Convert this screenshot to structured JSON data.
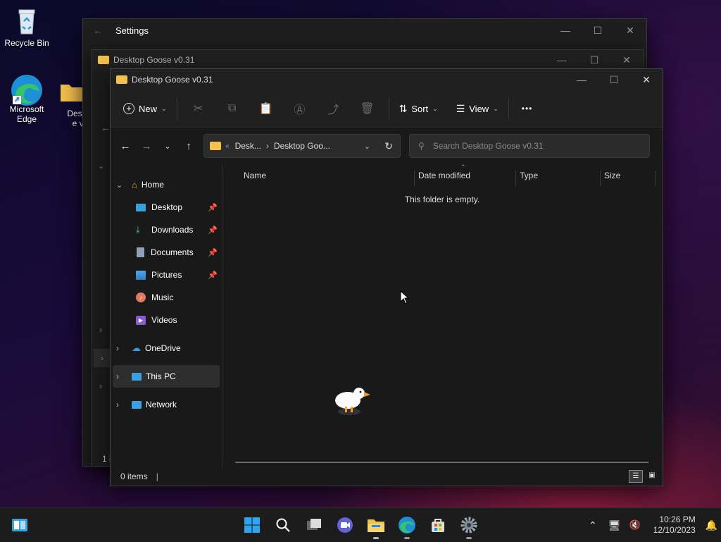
{
  "desktop": {
    "icons": [
      {
        "label": "Recycle Bin"
      },
      {
        "label": "Microsoft Edge"
      },
      {
        "label": "Deskto e v0"
      }
    ]
  },
  "settings_window": {
    "title": "Settings"
  },
  "mid_window": {
    "title": "Desktop Goose v0.31",
    "status_partial": "1 i"
  },
  "explorer": {
    "title": "Desktop Goose v0.31",
    "toolbar": {
      "new_label": "New",
      "sort_label": "Sort",
      "view_label": "View",
      "more_label": "•••"
    },
    "address": {
      "crumb_prefix": "«",
      "crumb1": "Desk...",
      "crumb_sep": "›",
      "crumb2": "Desktop Goo..."
    },
    "search": {
      "placeholder": "Search Desktop Goose v0.31"
    },
    "nav": {
      "home": "Home",
      "quick": [
        {
          "label": "Desktop",
          "pinned": true
        },
        {
          "label": "Downloads",
          "pinned": true
        },
        {
          "label": "Documents",
          "pinned": true
        },
        {
          "label": "Pictures",
          "pinned": true
        },
        {
          "label": "Music",
          "pinned": false
        },
        {
          "label": "Videos",
          "pinned": false
        }
      ],
      "onedrive": "OneDrive",
      "thispc": "This PC",
      "network": "Network"
    },
    "columns": {
      "name": "Name",
      "date": "Date modified",
      "type": "Type",
      "size": "Size"
    },
    "empty_message": "This folder is empty.",
    "status": {
      "items": "0 items",
      "cursor": "|"
    }
  },
  "taskbar": {
    "clock_time": "10:26 PM",
    "clock_date": "12/10/2023"
  },
  "colors": {
    "accent": "#0078d4",
    "folder": "#f2c14e",
    "window_bg": "#191919",
    "taskbar_bg": "#1c1c1c"
  }
}
